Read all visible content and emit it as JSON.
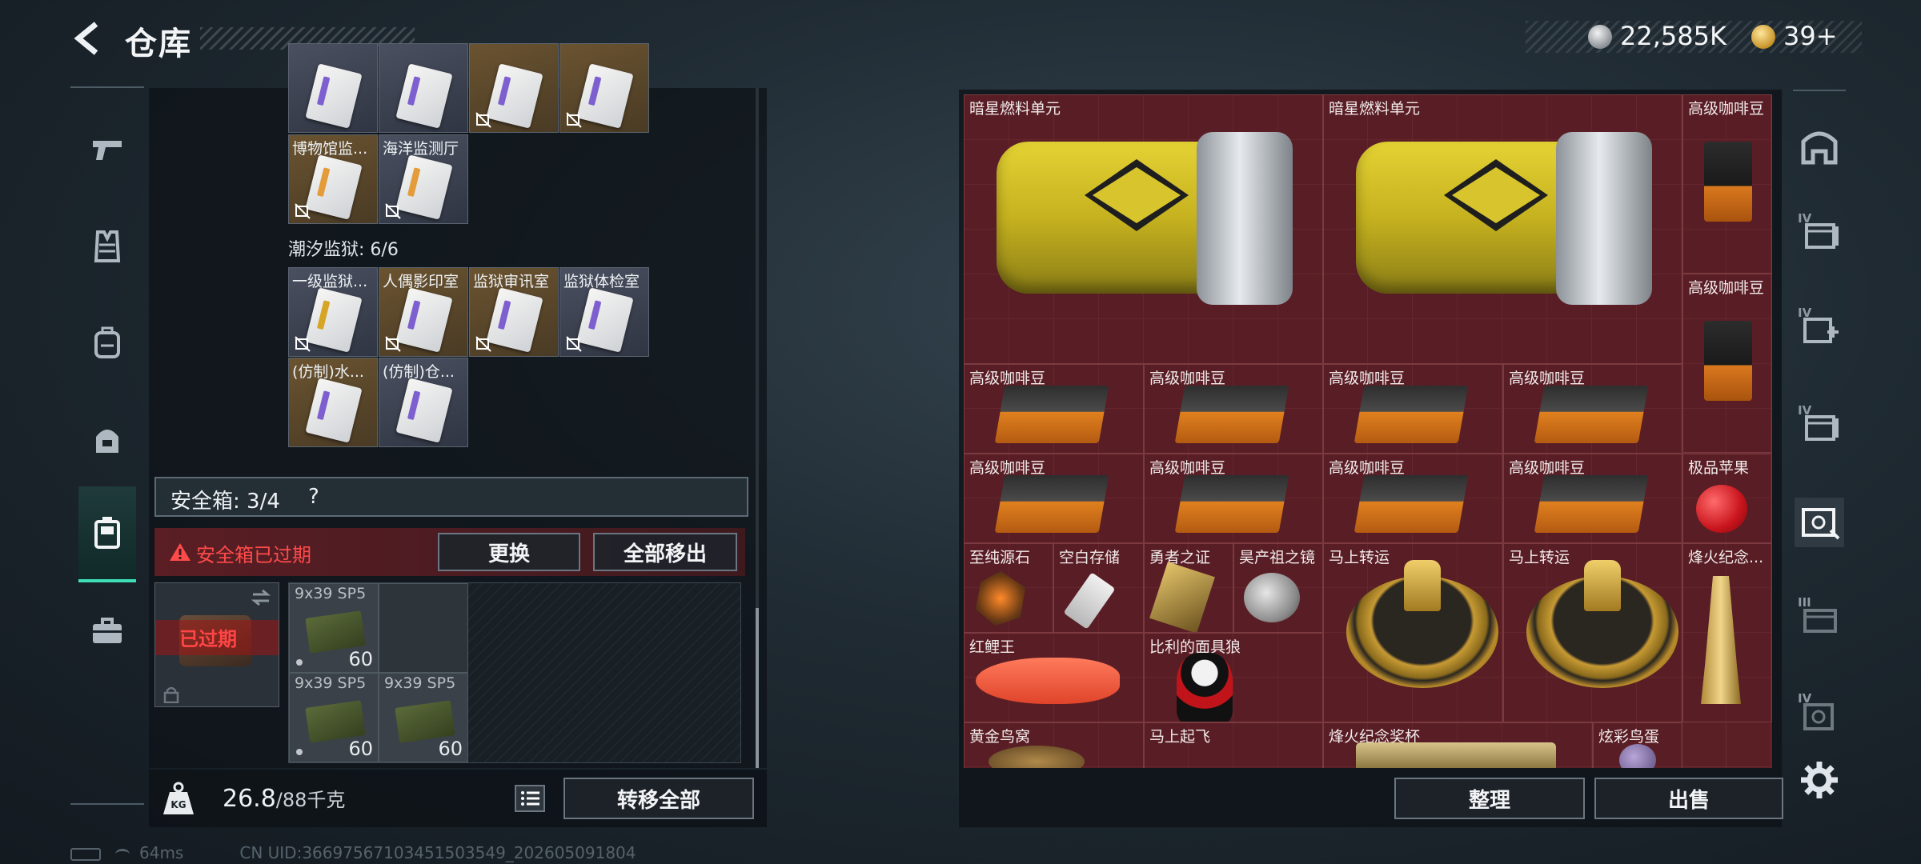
{
  "header": {
    "title": "仓库",
    "currency_main": "22,585K",
    "currency_premium": "39+"
  },
  "left_rail": {
    "icons": [
      "pistol-icon",
      "armor-vest-icon",
      "backpack-icon",
      "helmet-backpack-icon",
      "safe-box-icon",
      "briefcase-icon"
    ],
    "active": "safe-box-icon"
  },
  "keycards": {
    "top_row_partial": [
      "",
      "",
      "",
      ""
    ],
    "row2": [
      "博物馆监...",
      "海洋监测厅"
    ],
    "section_title": "潮汐监狱: 6/6",
    "row3": [
      "一级监狱...",
      "人偶影印室",
      "监狱审讯室",
      "监狱体检室"
    ],
    "row4": [
      "(仿制)水...",
      "(仿制)仓..."
    ]
  },
  "safe_box": {
    "label": "安全箱: 3/4",
    "help": "?",
    "expired_warning": "安全箱已过期",
    "replace_button": "更换",
    "remove_all_button": "全部移出",
    "box_status": "已过期",
    "ammo": [
      {
        "name": "9x39 SP5",
        "count": "60"
      },
      {
        "name": "9x39 SP5",
        "count": "60"
      },
      {
        "name": "9x39 SP5",
        "count": "60"
      }
    ]
  },
  "footer_left": {
    "weight_icon_label": "KG",
    "weight_current": "26.8",
    "weight_max": "/88千克",
    "transfer_all_button": "转移全部"
  },
  "status_bar": {
    "ping": "64ms",
    "uid": "CN UID:36697567103451503549_202605091804"
  },
  "inventory": {
    "items": [
      {
        "label": "暗星燃料单元"
      },
      {
        "label": "暗星燃料单元"
      },
      {
        "label": "高级咖啡豆"
      },
      {
        "label": "高级咖啡豆"
      },
      {
        "label": "高级咖啡豆"
      },
      {
        "label": "高级咖啡豆"
      },
      {
        "label": "高级咖啡豆"
      },
      {
        "label": "高级咖啡豆"
      },
      {
        "label": "高级咖啡豆"
      },
      {
        "label": "高级咖啡豆"
      },
      {
        "label": "高级咖啡豆"
      },
      {
        "label": "高级咖啡豆"
      },
      {
        "label": "极品苹果"
      },
      {
        "label": "至纯源石"
      },
      {
        "label": "空白存储"
      },
      {
        "label": "勇者之证"
      },
      {
        "label": "昊产祖之镜"
      },
      {
        "label": "马上转运"
      },
      {
        "label": "马上转运"
      },
      {
        "label": "烽火纪念..."
      },
      {
        "label": "红鲤王"
      },
      {
        "label": "比利的面具狼"
      },
      {
        "label": "黄金鸟窝"
      },
      {
        "label": "马上起飞"
      },
      {
        "label": "烽火纪念奖杯"
      },
      {
        "label": "炫彩鸟蛋"
      }
    ],
    "organize_button": "整理",
    "sell_button": "出售"
  },
  "right_rail": {
    "tiers": [
      "",
      "IV",
      "IV",
      "IV",
      "",
      "III",
      "IV"
    ]
  },
  "colors": {
    "accent": "#3fe0b8",
    "danger": "#ff4a4a",
    "grid_bg": "#5a1f25"
  }
}
